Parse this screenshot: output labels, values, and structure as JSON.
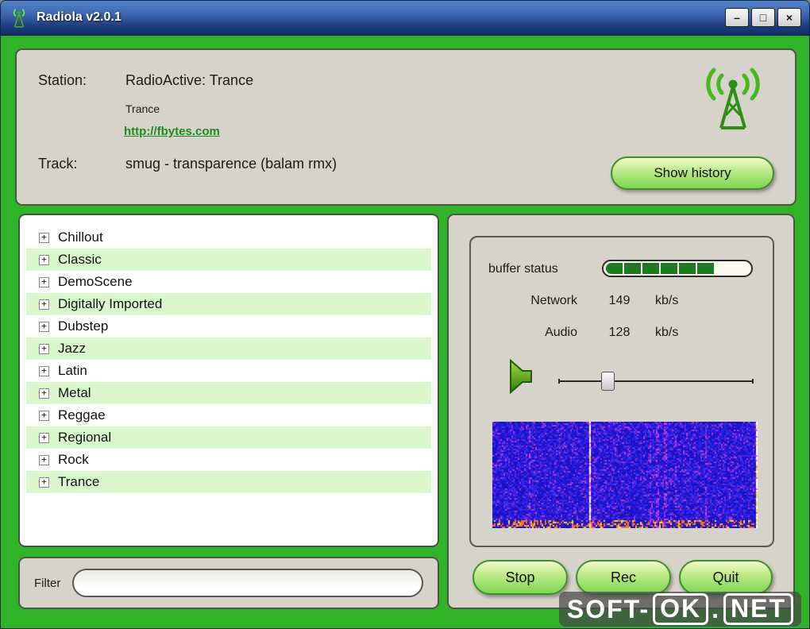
{
  "window": {
    "title": "Radiola v2.0.1",
    "minimize_glyph": "–",
    "maximize_glyph": "□",
    "close_glyph": "×"
  },
  "station": {
    "station_label": "Station:",
    "station_value": "RadioActive: Trance",
    "genre": "Trance",
    "url": "http://fbytes.com",
    "track_label": "Track:",
    "track_value": "smug -  transparence (balam rmx)",
    "show_history": "Show history"
  },
  "genres": {
    "items": [
      "Chillout",
      "Classic",
      "DemoScene",
      "Digitally Imported",
      "Dubstep",
      "Jazz",
      "Latin",
      "Metal",
      "Reggae",
      "Regional",
      "Rock",
      "Trance"
    ]
  },
  "filter": {
    "label": "Filter",
    "value": ""
  },
  "status": {
    "buffer_label": "buffer status",
    "buffer_filled_segments": 6,
    "network_label": "Network",
    "network_value": "149",
    "network_unit": "kb/s",
    "audio_label": "Audio",
    "audio_value": "128",
    "audio_unit": "kb/s",
    "volume_percent": 25
  },
  "buttons": {
    "stop": "Stop",
    "rec": "Rec",
    "quit": "Quit"
  },
  "watermark": {
    "text": "SOFT-OK.NET",
    "prefix": "SOFT-",
    "ok": "OK",
    "dot": ".",
    "net": "NET"
  },
  "colors": {
    "background_green": "#2fb428",
    "panel_beige": "#d6d3ca",
    "row_stripe": "#d9f7cd",
    "link_green": "#1f8a1f",
    "segment_green": "#1d7d1d",
    "titlebar_blue": "#2e55a0"
  }
}
